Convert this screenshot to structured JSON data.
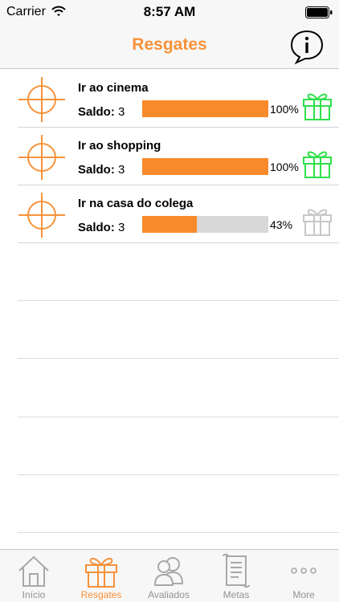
{
  "status_bar": {
    "carrier": "Carrier",
    "time": "8:57 AM"
  },
  "nav": {
    "title": "Resgates",
    "info_icon": "info-speech-bubble-icon"
  },
  "colors": {
    "accent": "#f7923a",
    "progress": "#f98a2c",
    "gift_ready": "#2ee04a",
    "gift_locked": "#c8c8c8"
  },
  "rewards": [
    {
      "title": "Ir ao cinema",
      "saldo_label": "Saldo:",
      "saldo_value": "3",
      "progress": 1.0,
      "percent": "100%",
      "gift_state": "available"
    },
    {
      "title": "Ir ao shopping",
      "saldo_label": "Saldo:",
      "saldo_value": "3",
      "progress": 1.0,
      "percent": "100%",
      "gift_state": "available"
    },
    {
      "title": "Ir na casa do colega",
      "saldo_label": "Saldo:",
      "saldo_value": "3",
      "progress": 0.43,
      "percent": "43%",
      "gift_state": "locked"
    }
  ],
  "tabs": [
    {
      "label": "Início",
      "icon": "house-icon",
      "active": false
    },
    {
      "label": "Resgates",
      "icon": "gift-icon",
      "active": true
    },
    {
      "label": "Avaliados",
      "icon": "people-icon",
      "active": false
    },
    {
      "label": "Metas",
      "icon": "scroll-icon",
      "active": false
    },
    {
      "label": "More",
      "icon": "more-dots-icon",
      "active": false
    }
  ]
}
